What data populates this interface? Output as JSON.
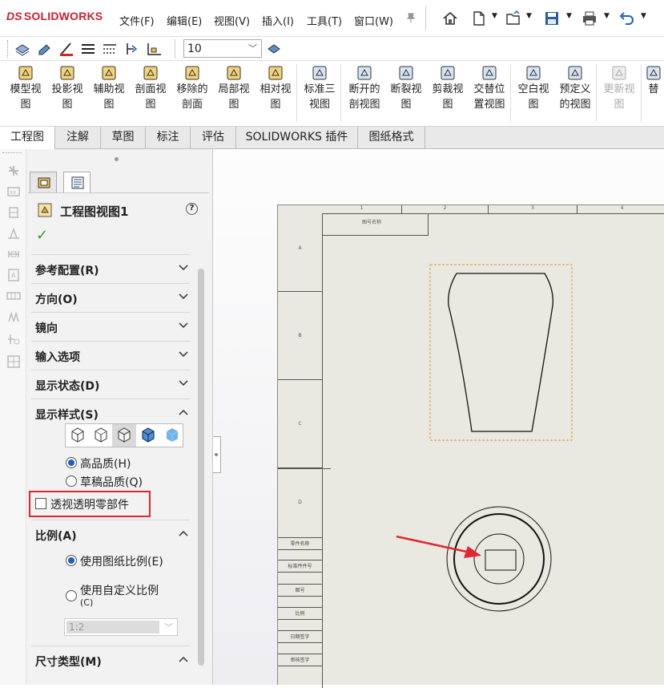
{
  "app": {
    "logo_text": "SOLIDWORKS",
    "logo_prefix": "DS",
    "brand_color": "#cc1f2e"
  },
  "menu": [
    "文件(F)",
    "编辑(E)",
    "视图(V)",
    "插入(I)",
    "工具(T)",
    "窗口(W)"
  ],
  "quick_access_icons": [
    "home-icon",
    "new-document-icon",
    "open-icon",
    "save-icon",
    "print-icon",
    "undo-icon"
  ],
  "toolbar2": {
    "font_size_value": "10"
  },
  "command_buttons": [
    {
      "label1": "模型视",
      "label2": "图",
      "icon": "model-view-icon"
    },
    {
      "label1": "投影视",
      "label2": "图",
      "icon": "projected-view-icon"
    },
    {
      "label1": "辅助视",
      "label2": "图",
      "icon": "auxiliary-view-icon"
    },
    {
      "label1": "剖面视",
      "label2": "图",
      "icon": "section-view-icon"
    },
    {
      "label1": "移除的",
      "label2": "剖面",
      "icon": "removed-section-icon"
    },
    {
      "label1": "局部视",
      "label2": "图",
      "icon": "detail-view-icon"
    },
    {
      "label1": "相对视",
      "label2": "图",
      "icon": "relative-view-icon"
    },
    {
      "label1": "标准三",
      "label2": "视图",
      "icon": "standard-3view-icon"
    },
    {
      "label1": "断开的",
      "label2": "剖视图",
      "icon": "broken-out-section-icon"
    },
    {
      "label1": "断裂视",
      "label2": "图",
      "icon": "break-view-icon"
    },
    {
      "label1": "剪裁视",
      "label2": "图",
      "icon": "crop-view-icon"
    },
    {
      "label1": "交替位",
      "label2": "置视图",
      "icon": "alternate-position-icon"
    },
    {
      "label1": "空白视",
      "label2": "图",
      "icon": "empty-view-icon"
    },
    {
      "label1": "预定义",
      "label2": "的视图",
      "icon": "predefined-view-icon"
    },
    {
      "label1": "更新视",
      "label2": "图",
      "icon": "update-view-icon"
    },
    {
      "label1": "替",
      "label2": "",
      "icon": "replace-icon"
    }
  ],
  "tabs": [
    "工程图",
    "注解",
    "草图",
    "标注",
    "评估",
    "SOLIDWORKS 插件",
    "图纸格式"
  ],
  "panel": {
    "title": "工程图视图1",
    "sections": {
      "ref_config": "参考配置(R)",
      "orientation": "方向(O)",
      "mirror": "镜向",
      "import_options": "输入选项",
      "display_state": "显示状态(D)",
      "display_style": "显示样式(S)",
      "scale": "比例(A)",
      "dim_type": "尺寸类型(M)"
    },
    "quality_high": "高品质(H)",
    "quality_draft": "草稿品质(Q)",
    "transparent_parts": "透视透明零部件",
    "use_sheet_scale": "使用图纸比例(E)",
    "use_custom_scale": "使用自定义比例",
    "use_custom_scale_key": "(C)",
    "custom_scale_value": "1:2",
    "highlight_color": "#e0282e"
  },
  "sheet": {
    "col_labels": [
      "1",
      "2",
      "3",
      "4"
    ],
    "row_labels": [
      "A",
      "B",
      "C",
      "D"
    ],
    "title_box_text": "图号名称",
    "side_table_rows": [
      "零件名称",
      "标准件件号",
      "图号",
      "比例",
      "日期签字",
      "审核签字"
    ]
  }
}
